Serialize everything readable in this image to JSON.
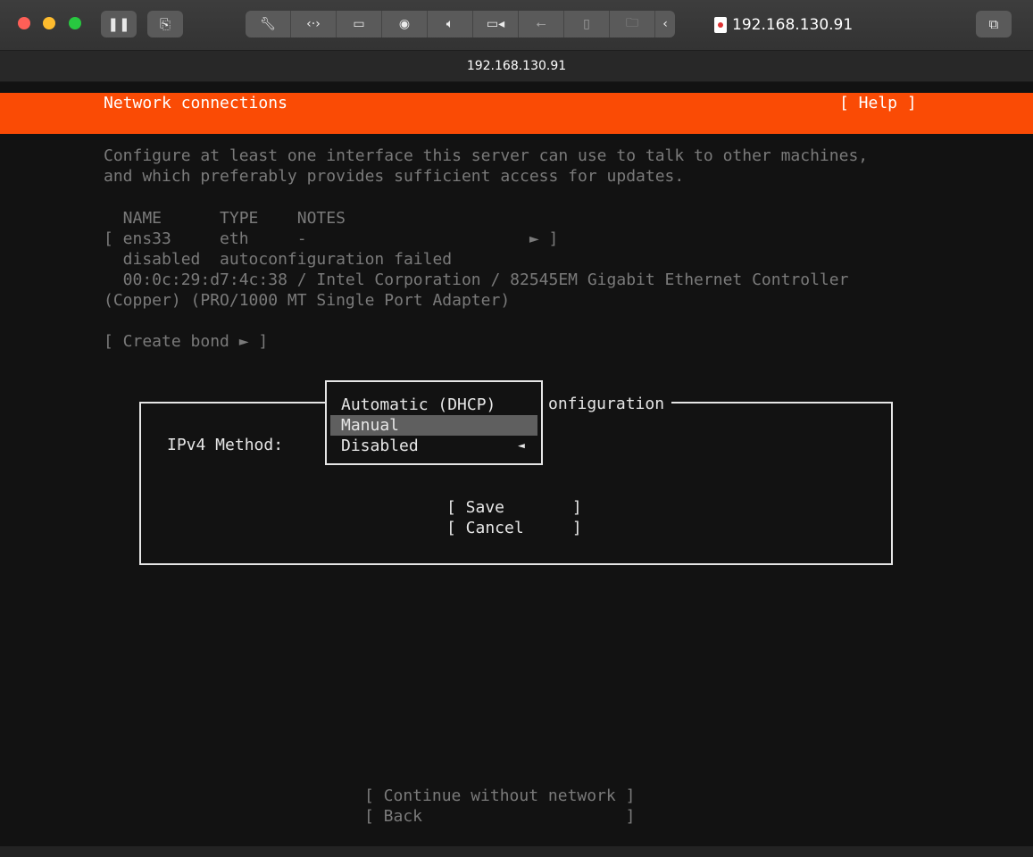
{
  "window": {
    "title": "192.168.130.91",
    "tab_title": "192.168.130.91",
    "toolbar_icons": [
      "pause-icon",
      "snapshot-icon",
      "wrench-icon",
      "network-arrows-icon",
      "hard-disk-icon",
      "camera-icon",
      "speaker-icon",
      "video-camera-icon",
      "usb-icon",
      "mouse-icon",
      "shared-folder-icon",
      "chevron-left-icon",
      "windows-icon"
    ]
  },
  "installer": {
    "header_title": "Network connections",
    "help_label": "[ Help ]",
    "intro_line1": "Configure at least one interface this server can use to talk to other machines,",
    "intro_line2": "and which preferably provides sufficient access for updates.",
    "table": {
      "headers": "  NAME      TYPE    NOTES",
      "row_line": "[ ens33     eth     -                       ► ]",
      "status_line": "  disabled  autoconfiguration failed",
      "device_line1": "  00:0c:29:d7:4c:38 / Intel Corporation / 82545EM Gigabit Ethernet Controller",
      "device_line2": "(Copper) (PRO/1000 MT Single Port Adapter)"
    },
    "create_bond": "[ Create bond ► ]",
    "continue_label": "[ Continue without network ]",
    "back_label": "[ Back                     ]"
  },
  "dialog": {
    "title_visible": "onfiguration",
    "ipv4_label": "IPv4 Method:",
    "options": [
      "Automatic (DHCP)",
      "Manual",
      "Disabled"
    ],
    "selected_index": 1,
    "selected_arrow": "◄",
    "save_label": "[ Save       ]",
    "cancel_label": "[ Cancel     ]"
  },
  "colors": {
    "header_bg": "#fa4b05",
    "terminal_bg": "#121212",
    "highlight_bg": "#5f5f5f",
    "dim_text": "#7a7a7a",
    "bright_text": "#e6e6e6"
  }
}
